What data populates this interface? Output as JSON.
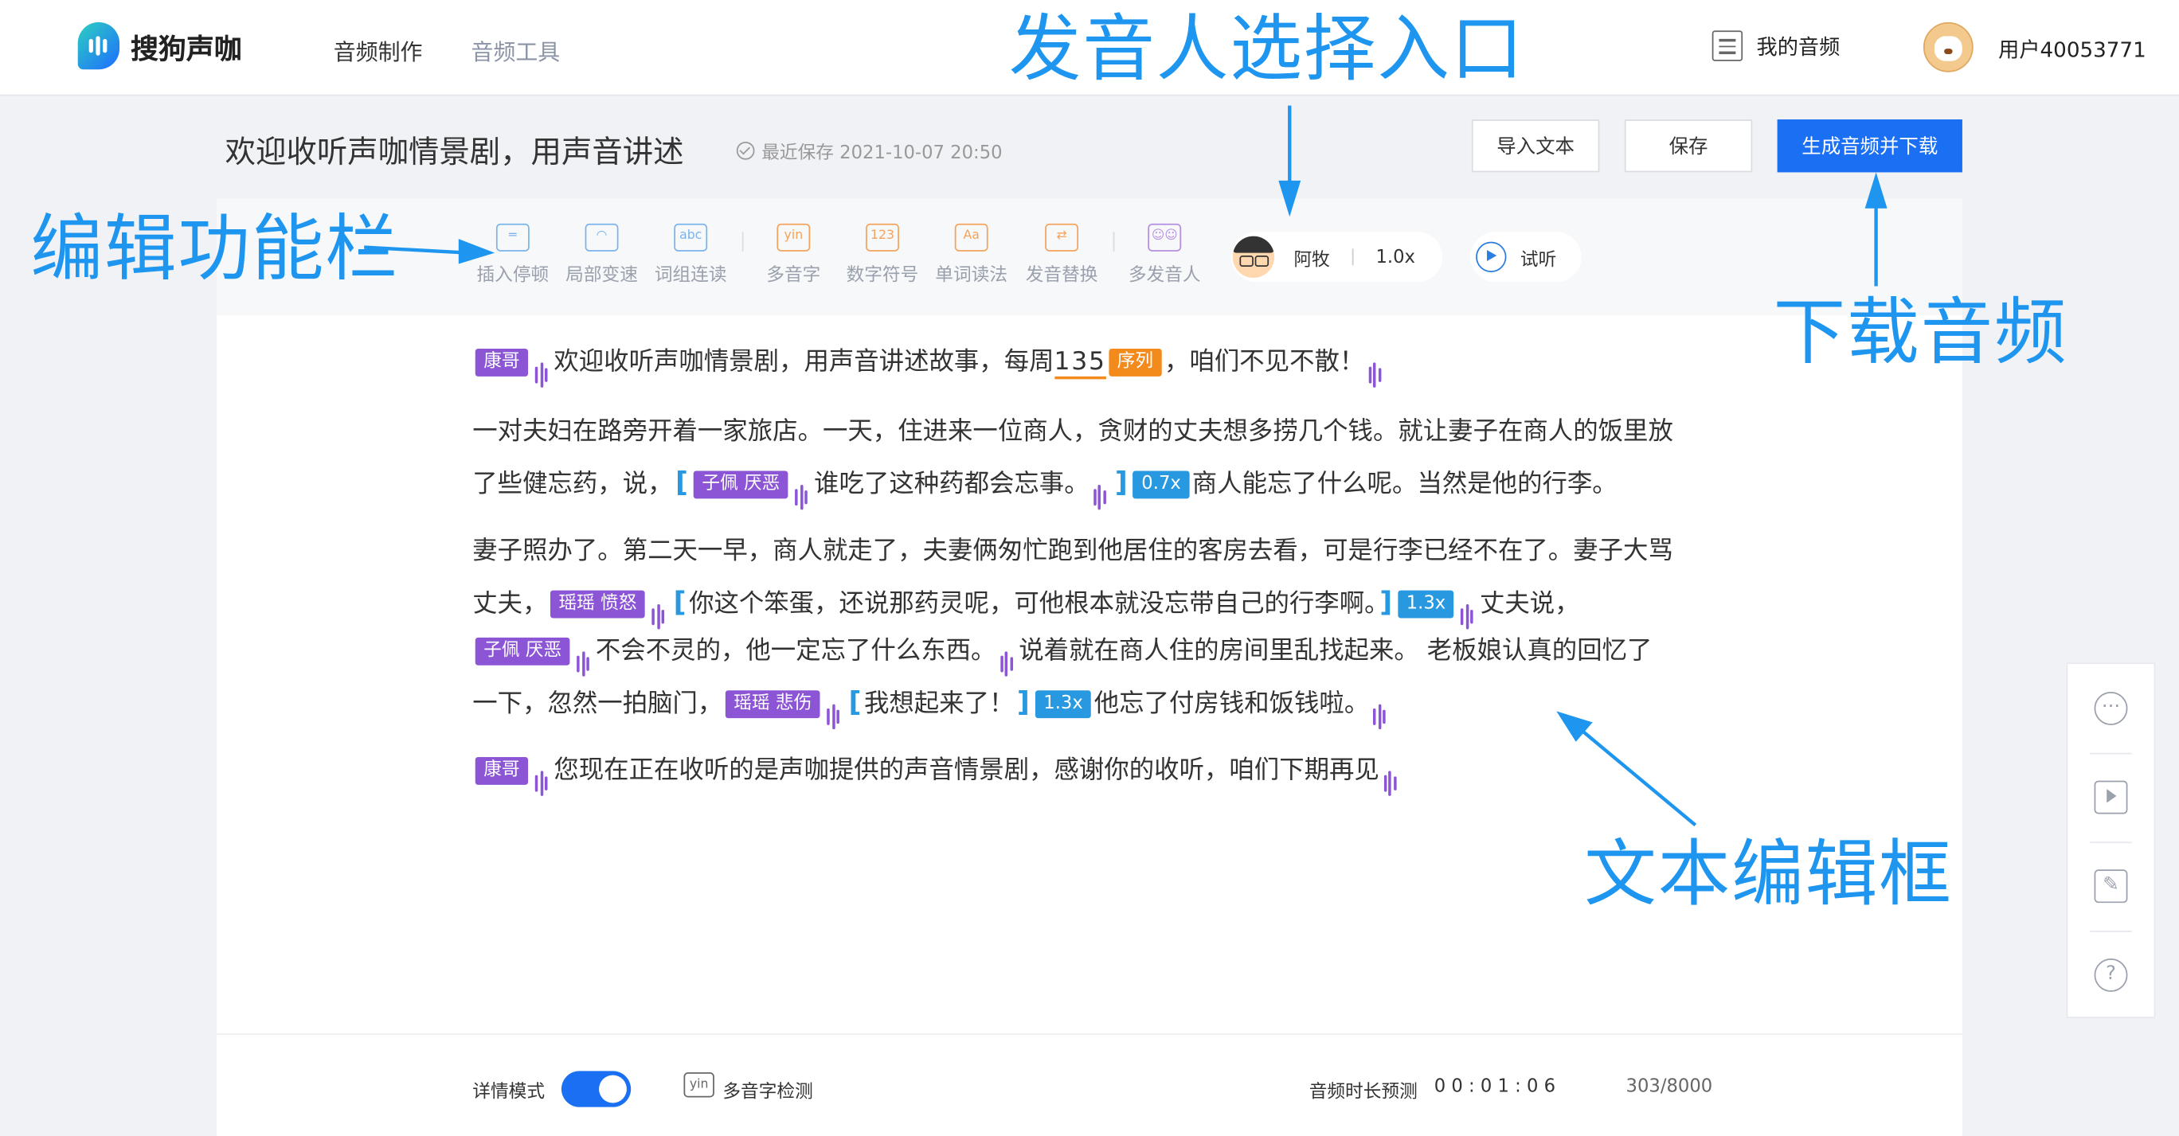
{
  "brand": {
    "name": "搜狗声咖"
  },
  "nav": [
    {
      "label": "音频制作"
    },
    {
      "label": "音频工具"
    }
  ],
  "header": {
    "my_audio": "我的音频",
    "username": "用户40053771"
  },
  "annotations": {
    "speaker_entry": "发音人选择入口",
    "edit_bar": "编辑功能栏",
    "download": "下载音频",
    "text_box": "文本编辑框"
  },
  "doc": {
    "title": "欢迎收听声咖情景剧，用声音讲述",
    "save_status": "最近保存 2021-10-07 20:50"
  },
  "buttons": {
    "import": "导入文本",
    "save": "保存",
    "generate": "生成音频并下载"
  },
  "toolbar": {
    "tools": [
      {
        "label": "插入停顿",
        "icon": "pause-insert-icon"
      },
      {
        "label": "局部变速",
        "icon": "speed-gauge-icon"
      },
      {
        "label": "词组连读",
        "icon": "abc-icon"
      },
      {
        "label": "多音字",
        "icon": "yin-icon",
        "glyph": "yin"
      },
      {
        "label": "数字符号",
        "icon": "number-icon",
        "glyph": "123"
      },
      {
        "label": "单词读法",
        "icon": "word-icon",
        "glyph": "Aa"
      },
      {
        "label": "发音替换",
        "icon": "replace-icon"
      },
      {
        "label": "多发音人",
        "icon": "multi-speaker-icon"
      }
    ],
    "speaker": {
      "name": "阿牧",
      "speed": "1.0x"
    },
    "listen": "试听"
  },
  "content": {
    "tag_kangge": "康哥",
    "tag_xulie": "序列",
    "tag_zipei": "子佩  厌恶",
    "tag_yaoyao_anger": "瑶瑶  愤怒",
    "tag_yaoyao_sad": "瑶瑶  悲伤",
    "speed_07": "0.7x",
    "speed_13": "1.3x",
    "p1_a": "欢迎收听声咖情景剧，用声音讲述故事，每周",
    "p1_num": "135",
    "p1_b": "，咱们不见不散！",
    "p2_l1": "一对夫妇在路旁开着一家旅店。一天，住进来一位商人，贪财的丈夫想多捞几个钱。就让妻子在商人的饭里放",
    "p2_l2a": "了些健忘药，说，",
    "p2_l2b": "谁吃了这种药都会忘事。",
    "p2_l2c": "商人能忘了什么呢。当然是他的行李。",
    "p3_l1": "妻子照办了。第二天一早，商人就走了，夫妻俩匆忙跑到他居住的客房去看，可是行李已经不在了。妻子大骂",
    "p3_l2a": "丈夫，",
    "p3_l2b": "你这个笨蛋，还说那药灵呢，可他根本就没忘带自己的行李啊。",
    "p3_l2c": "丈夫说，",
    "p3_l3a": "不会不灵的，他一定忘了什么东西。",
    "p3_l3b": "说着就在商人住的房间里乱找起来。 老板娘认真的回忆了",
    "p3_l4a": "一下，忽然一拍脑门，",
    "p3_l4b": "我想起来了！",
    "p3_l4c": "他忘了付房钱和饭钱啦。",
    "p4": "您现在正在收听的是声咖提供的声音情景剧，感谢你的收听，咱们下期再见"
  },
  "footer": {
    "detail_mode": "详情模式",
    "polyphone_check": "多音字检测",
    "duration_label": "音频时长预测",
    "duration_value": "0 0 : 0 1 : 0 6",
    "char_count": "303/8000"
  },
  "colors": {
    "accent": "#1a6ff2",
    "annotation": "#1e96f0",
    "tag_purple": "#8b55d6",
    "tag_orange": "#f28a1c",
    "tag_blue": "#2899e0"
  }
}
